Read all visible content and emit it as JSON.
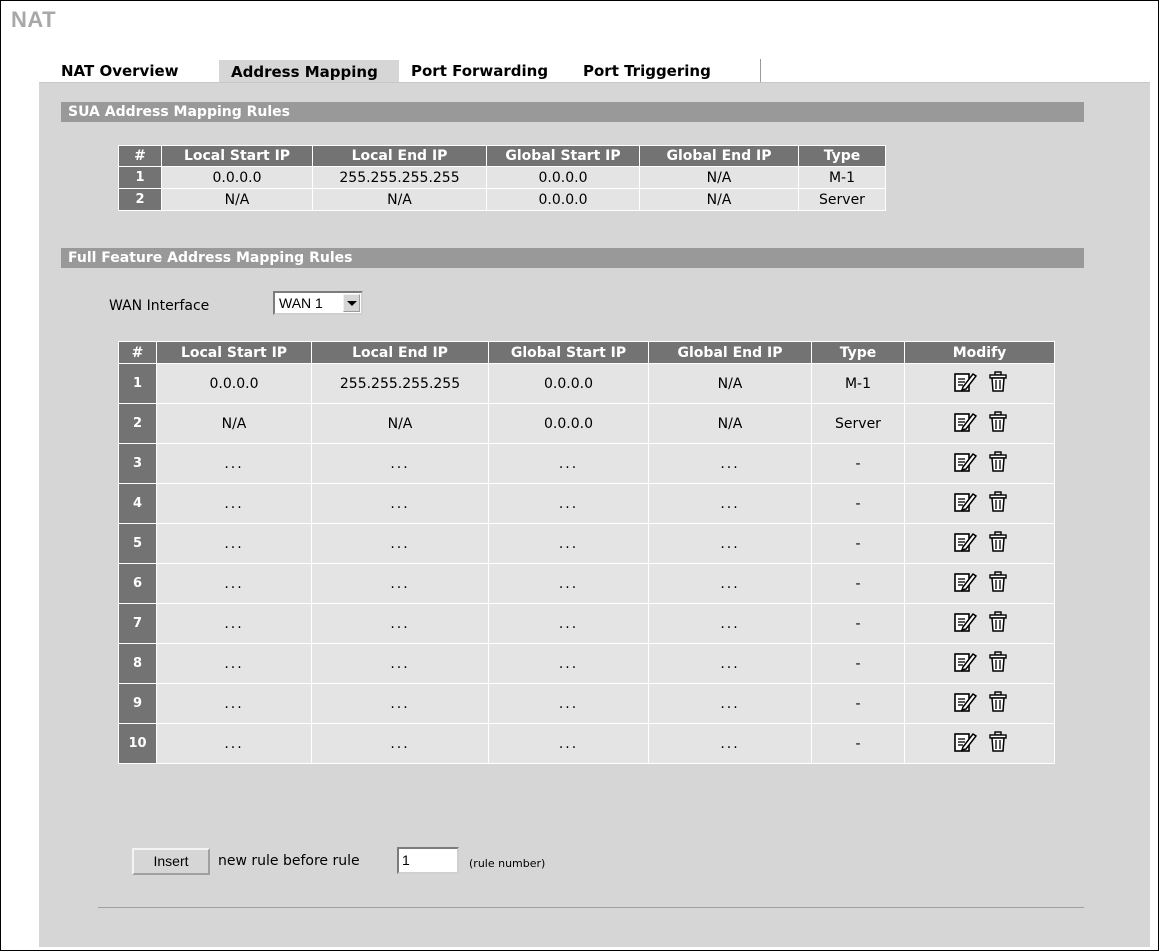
{
  "page": {
    "title": "NAT"
  },
  "tabs": [
    {
      "label": "NAT Overview",
      "active": false
    },
    {
      "label": "Address Mapping",
      "active": true
    },
    {
      "label": "Port Forwarding",
      "active": false
    },
    {
      "label": "Port Triggering",
      "active": false
    }
  ],
  "sua": {
    "title": "SUA Address Mapping Rules",
    "columns": [
      "#",
      "Local Start IP",
      "Local End IP",
      "Global Start IP",
      "Global End IP",
      "Type"
    ],
    "rows": [
      [
        "1",
        "0.0.0.0",
        "255.255.255.255",
        "0.0.0.0",
        "N/A",
        "M-1"
      ],
      [
        "2",
        "N/A",
        "N/A",
        "0.0.0.0",
        "N/A",
        "Server"
      ]
    ]
  },
  "full": {
    "title": "Full Feature Address Mapping Rules",
    "wan_label": "WAN Interface",
    "wan_value": "WAN 1",
    "columns": [
      "#",
      "Local Start IP",
      "Local End IP",
      "Global Start IP",
      "Global End IP",
      "Type",
      "Modify"
    ],
    "rows": [
      [
        "1",
        "0.0.0.0",
        "255.255.255.255",
        "0.0.0.0",
        "N/A",
        "M-1"
      ],
      [
        "2",
        "N/A",
        "N/A",
        "0.0.0.0",
        "N/A",
        "Server"
      ],
      [
        "3",
        "...",
        "...",
        "...",
        "...",
        "-"
      ],
      [
        "4",
        "...",
        "...",
        "...",
        "...",
        "-"
      ],
      [
        "5",
        "...",
        "...",
        "...",
        "...",
        "-"
      ],
      [
        "6",
        "...",
        "...",
        "...",
        "...",
        "-"
      ],
      [
        "7",
        "...",
        "...",
        "...",
        "...",
        "-"
      ],
      [
        "8",
        "...",
        "...",
        "...",
        "...",
        "-"
      ],
      [
        "9",
        "...",
        "...",
        "...",
        "...",
        "-"
      ],
      [
        "10",
        "...",
        "...",
        "...",
        "...",
        "-"
      ]
    ],
    "modify_icons": [
      "edit-icon",
      "trash-icon"
    ]
  },
  "insert": {
    "button_label": "Insert",
    "text": "new rule before rule",
    "rule_value": "1",
    "hint": "(rule number)"
  }
}
